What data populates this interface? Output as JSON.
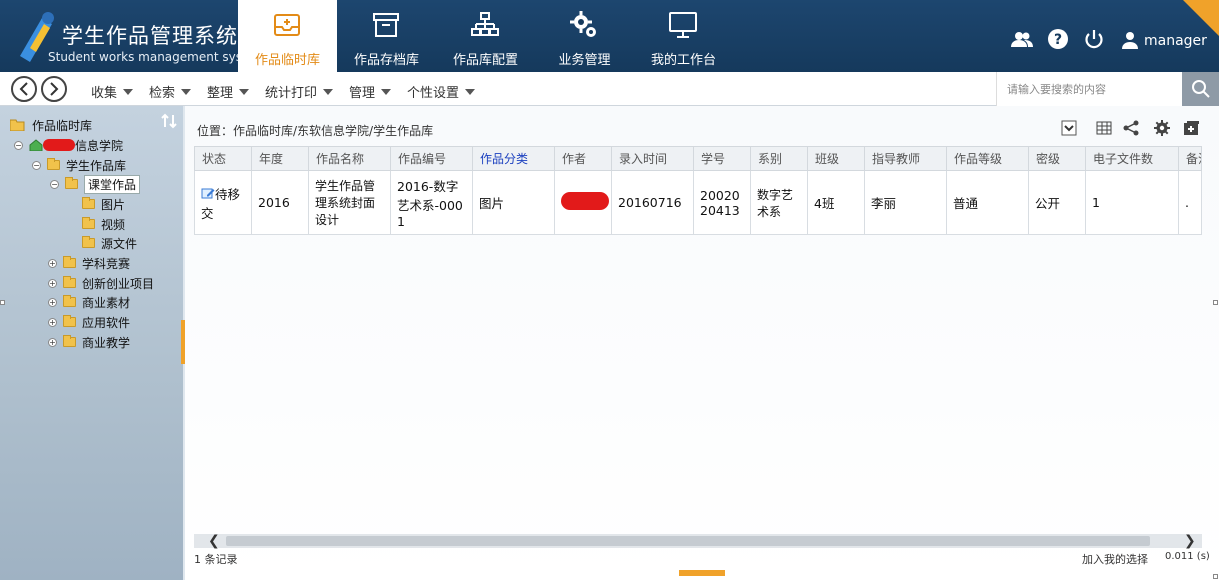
{
  "app": {
    "title": "学生作品管理系统",
    "subtitle": "Student works management system"
  },
  "nav": {
    "tabs": [
      {
        "label": "作品临时库",
        "icon": "inbox-icon",
        "active": true
      },
      {
        "label": "作品存档库",
        "icon": "archive-icon",
        "active": false
      },
      {
        "label": "作品库配置",
        "icon": "sitemap-icon",
        "active": false
      },
      {
        "label": "业务管理",
        "icon": "gears-icon",
        "active": false
      },
      {
        "label": "我的工作台",
        "icon": "monitor-icon",
        "active": false
      }
    ]
  },
  "header": {
    "user": "manager",
    "icons": [
      "users-icon",
      "help-icon",
      "power-icon",
      "user-icon"
    ]
  },
  "toolbar": {
    "menus": [
      "收集",
      "检索",
      "整理",
      "统计打印",
      "管理",
      "个性设置"
    ],
    "search_placeholder": "请输入要搜索的内容"
  },
  "tree": {
    "root": "作品临时库",
    "college_suffix": "信息学院",
    "library": "学生作品库",
    "category": "课堂作品",
    "subfolders": [
      "图片",
      "视频",
      "源文件"
    ],
    "others": [
      "学科竞赛",
      "创新创业项目",
      "商业素材",
      "应用软件",
      "商业教学"
    ]
  },
  "main": {
    "breadcrumb": "位置：作品临时库/东软信息学院/学生作品库",
    "columns": [
      "状态",
      "年度",
      "作品名称",
      "作品编号",
      "作品分类",
      "作者",
      "录入时间",
      "学号",
      "系别",
      "班级",
      "指导教师",
      "作品等级",
      "密级",
      "电子文件数",
      "备注"
    ],
    "rows": [
      {
        "status": "待移交",
        "year": "2016",
        "name": "学生作品管理系统封面设计",
        "code": "2016-数字艺术系-0001",
        "category": "图片",
        "author": "",
        "entry_time": "20160716",
        "student_id": "2002020413",
        "department": "数字艺术系",
        "class": "4班",
        "teacher": "李丽",
        "grade": "普通",
        "secrecy": "公开",
        "files": "1",
        "remark": "."
      }
    ],
    "record_count": "1 条记录",
    "add_selection": "加入我的选择",
    "timing": "0.011 (s)"
  },
  "colors": {
    "header_bg": "#1d466f",
    "accent": "#e38b17",
    "redaction": "#e21a1a",
    "highlight_header": "#1a3fbf"
  }
}
